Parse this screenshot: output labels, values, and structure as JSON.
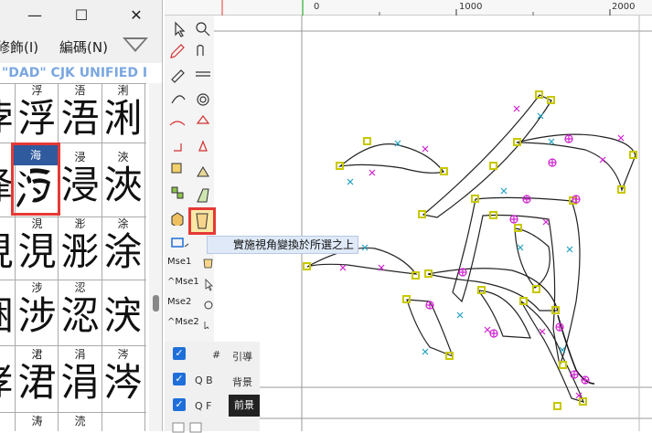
{
  "window": {
    "minimize": "—",
    "maximize": "☐",
    "close": "✕"
  },
  "menu": {
    "item1": "修飾(I)",
    "item2": "編碼(N)"
  },
  "banner": "\"DAD\" CJK UNIFIED I",
  "grid": {
    "rows": [
      {
        "cells": [
          {
            "label": "",
            "glyph": "浡"
          },
          {
            "label": "浮",
            "glyph": "浮"
          },
          {
            "label": "浯",
            "glyph": "浯"
          },
          {
            "label": "浰",
            "glyph": "浰"
          }
        ]
      },
      {
        "cells": [
          {
            "label": "",
            "glyph": "浲"
          },
          {
            "label": "海",
            "glyph": "海"
          },
          {
            "label": "浸",
            "glyph": "浸"
          },
          {
            "label": "浹",
            "glyph": "浹"
          }
        ]
      },
      {
        "cells": [
          {
            "label": "",
            "glyph": "涀"
          },
          {
            "label": "涀",
            "glyph": "涀"
          },
          {
            "label": "浵",
            "glyph": "浵"
          },
          {
            "label": "涂",
            "glyph": "涂"
          }
        ]
      },
      {
        "cells": [
          {
            "label": "",
            "glyph": "涃"
          },
          {
            "label": "涉",
            "glyph": "涉"
          },
          {
            "label": "涊",
            "glyph": "涊"
          },
          {
            "label": "",
            "glyph": "涋"
          }
        ]
      },
      {
        "cells": [
          {
            "label": "",
            "glyph": "涍"
          },
          {
            "label": "涒",
            "glyph": "涒"
          },
          {
            "label": "涓",
            "glyph": "涓"
          },
          {
            "label": "涔",
            "glyph": "涔"
          }
        ]
      },
      {
        "cells": [
          {
            "label": "",
            "glyph": ""
          },
          {
            "label": "涛",
            "glyph": ""
          },
          {
            "label": "涜",
            "glyph": ""
          },
          {
            "label": "",
            "glyph": ""
          }
        ]
      }
    ],
    "selected_label": "海"
  },
  "toolbox": {
    "mse1": "Mse1",
    "cmse1": "^Mse1",
    "mse2": "Mse2",
    "cmse2": "^Mse2",
    "tooltip": "實施視角變換於所選之上"
  },
  "layers": [
    {
      "key": "#",
      "name": "引導"
    },
    {
      "key": "Q  B",
      "name": "背景"
    },
    {
      "key": "Q  F",
      "name": "前景"
    }
  ],
  "ruler": {
    "labels": [
      "0",
      "1000",
      "2000"
    ]
  },
  "colors": {
    "accent_red": "#e53935",
    "selection_blue": "#2f5a9e",
    "point_yellow": "#c8c800",
    "handle_magenta": "#d020d0",
    "handle_cyan": "#20a0c0"
  }
}
